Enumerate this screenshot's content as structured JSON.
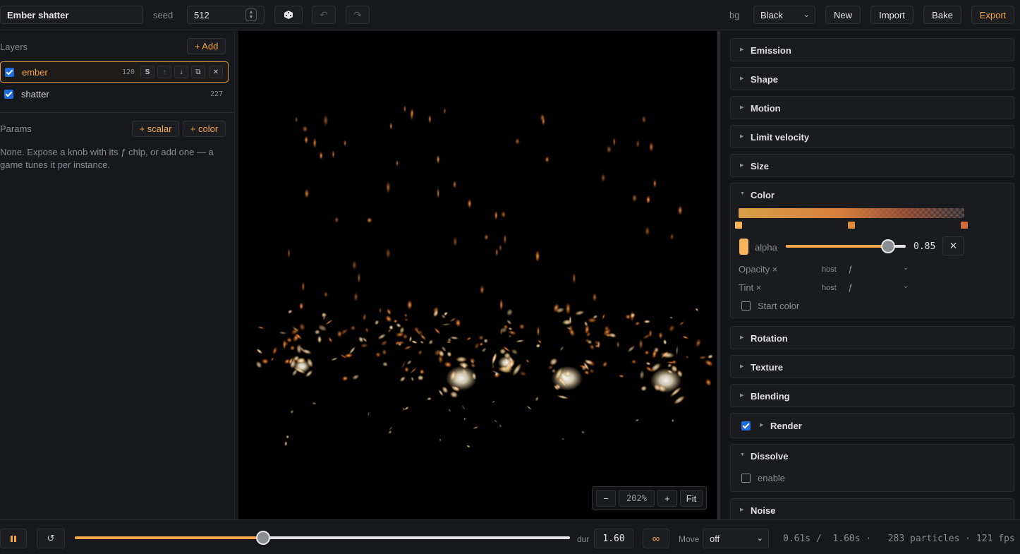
{
  "toolbar": {
    "title": "Ember shatter",
    "seed_label": "seed",
    "seed_value": "512",
    "bg_label": "bg",
    "bg_value": "Black",
    "new_label": "New",
    "import_label": "Import",
    "bake_label": "Bake",
    "export_label": "Export",
    "icons": {
      "dice": "dice-icon",
      "undo": "undo-icon",
      "redo": "redo-icon"
    }
  },
  "layers": {
    "title": "Layers",
    "add_label": "+ Add",
    "items": [
      {
        "name": "ember",
        "count": "120",
        "solo_label": "S",
        "checked": true,
        "selected": true
      },
      {
        "name": "shatter",
        "count": "227",
        "checked": true,
        "selected": false
      }
    ]
  },
  "params": {
    "title": "Params",
    "add_scalar_label": "+ scalar",
    "add_color_label": "+ color",
    "empty_text": "None. Expose a knob with its ƒ chip, or add one — a game tunes it per instance."
  },
  "viewport": {
    "zoom_out_label": "−",
    "zoom_value": "202%",
    "zoom_in_label": "+",
    "fit_label": "Fit"
  },
  "modules": {
    "emission": "Emission",
    "shape": "Shape",
    "motion": "Motion",
    "limit_velocity": "Limit velocity",
    "size": "Size",
    "color": {
      "label": "Color",
      "gradient_stops": [
        {
          "position": 0.0,
          "color": "#f7b45a"
        },
        {
          "position": 0.5,
          "color": "#e08a3c"
        },
        {
          "position": 1.0,
          "color": "#d06a38"
        }
      ],
      "alpha_label": "alpha",
      "alpha_value": "0.85",
      "alpha_fraction": 0.85,
      "opacity": {
        "label": "Opacity ×",
        "source": "host",
        "fn": "ƒ"
      },
      "tint": {
        "label": "Tint ×",
        "source": "host",
        "fn": "ƒ"
      },
      "start_color_label": "Start color"
    },
    "rotation": "Rotation",
    "texture": "Texture",
    "blending": "Blending",
    "render": "Render",
    "dissolve": {
      "label": "Dissolve",
      "enable_label": "enable"
    },
    "noise": "Noise"
  },
  "playback": {
    "pause_icon": "pause-icon",
    "restart_icon": "restart-icon",
    "progress_fraction": 0.38,
    "dur_label": "dur",
    "dur_value": "1.60",
    "loop_label": "∞",
    "move_label": "Move",
    "move_value": "off",
    "stats": "0.61s /  1.60s ·   283 particles · 121 fps"
  },
  "colors": {
    "accent": "#f5a54a",
    "checkbox": "#1c6ce0",
    "background": "#151619"
  }
}
